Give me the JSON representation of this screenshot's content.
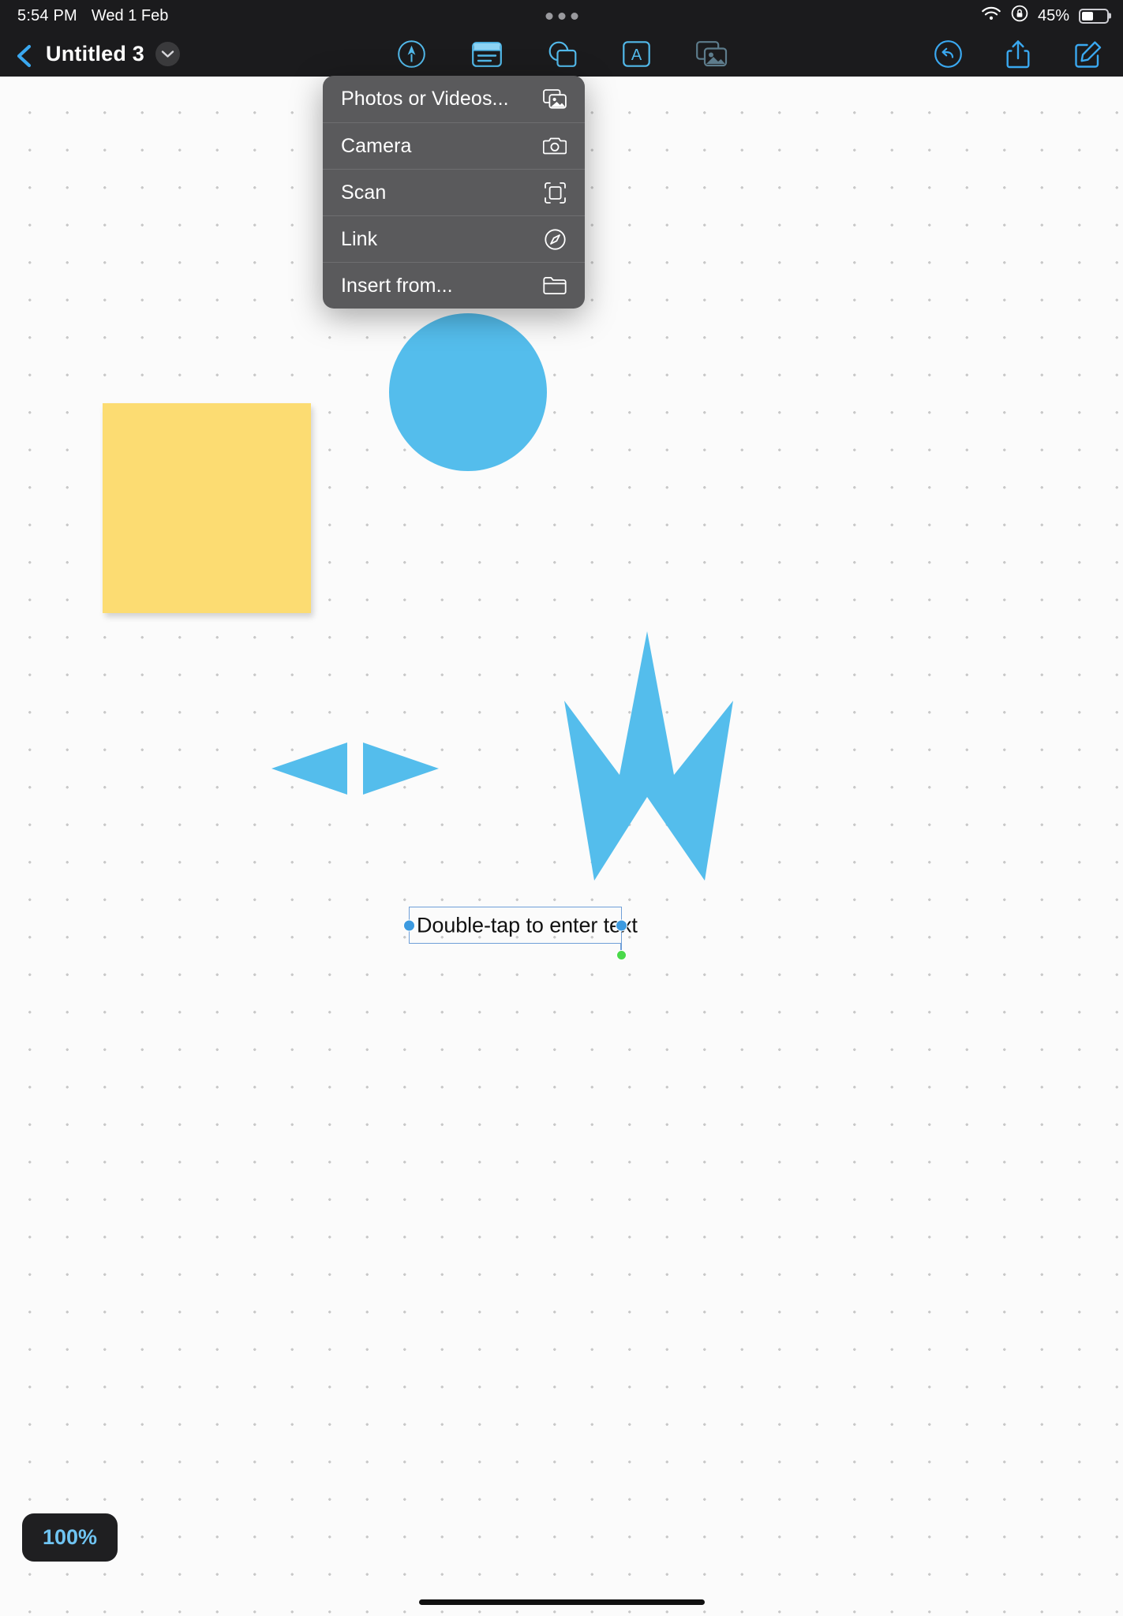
{
  "status_bar": {
    "time": "5:54 PM",
    "date": "Wed 1 Feb",
    "battery_percent": "45%",
    "wifi_icon": "wifi-icon",
    "rotation_lock_icon": "rotation-lock-icon",
    "battery_icon": "battery-icon",
    "multitasking_icon": "multitasking-dots-icon"
  },
  "navbar": {
    "back_icon": "back-chevron-icon",
    "title": "Untitled 3",
    "title_menu_icon": "chevron-down-icon",
    "tools": [
      {
        "name": "draw-tool",
        "icon": "pen-in-circle-icon"
      },
      {
        "name": "sticky-note-tool",
        "icon": "sticky-note-icon"
      },
      {
        "name": "shapes-tool",
        "icon": "shapes-icon"
      },
      {
        "name": "text-tool",
        "icon": "text-box-icon"
      },
      {
        "name": "media-tool",
        "icon": "photos-icon"
      }
    ],
    "actions": [
      {
        "name": "undo-button",
        "icon": "undo-arrow-icon"
      },
      {
        "name": "share-button",
        "icon": "share-icon"
      },
      {
        "name": "compose-button",
        "icon": "compose-icon"
      }
    ]
  },
  "media_menu": {
    "items": [
      {
        "label": "Photos or Videos...",
        "icon": "photos-icon"
      },
      {
        "label": "Camera",
        "icon": "camera-icon"
      },
      {
        "label": "Scan",
        "icon": "scan-icon"
      },
      {
        "label": "Link",
        "icon": "compass-link-icon"
      },
      {
        "label": "Insert from...",
        "icon": "folder-icon"
      }
    ]
  },
  "canvas": {
    "shapes": [
      {
        "name": "circle-shape",
        "type": "circle",
        "color": "#54bdec"
      },
      {
        "name": "square-shape",
        "type": "square",
        "color": "#fcdc72"
      },
      {
        "name": "double-arrow-shape",
        "type": "arrow",
        "color": "#54bdec"
      },
      {
        "name": "star-shape",
        "type": "star",
        "color": "#54bdec"
      }
    ],
    "text_box": {
      "text": "Double-tap to enter text",
      "selected": true,
      "border_color": "#6f9fd8",
      "handle_color": "#3c9ae0",
      "rotate_handle_color": "#4ad94a"
    },
    "zoom_level": "100%",
    "zoom_badge_color": "#6fc4f2"
  }
}
